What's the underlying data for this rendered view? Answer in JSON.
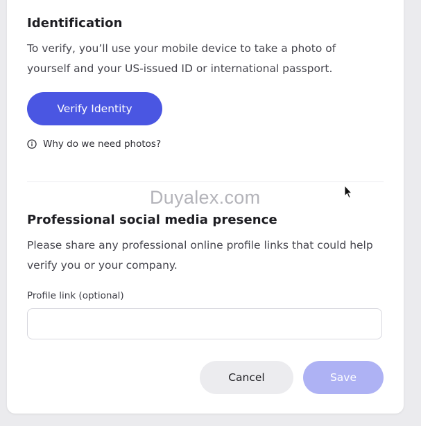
{
  "identification": {
    "title": "Identification",
    "description": "To verify, you’ll use your mobile device to take a photo of yourself and your US-issued ID or international passport.",
    "verify_button": "Verify Identity",
    "why_link": "Why do we need photos?"
  },
  "watermark": "Duyalex.com",
  "social": {
    "title": "Professional social media presence",
    "description": "Please share any professional online profile links that could help verify you or your company.",
    "field_label": "Profile link (optional)",
    "field_value": "",
    "field_placeholder": ""
  },
  "actions": {
    "cancel": "Cancel",
    "save": "Save"
  },
  "colors": {
    "primary": "#4a56e2",
    "primary_disabled": "#aeb2f4",
    "secondary_bg": "#ececef"
  },
  "icons": {
    "info": "info-icon",
    "cursor": "arrow-cursor-icon"
  }
}
